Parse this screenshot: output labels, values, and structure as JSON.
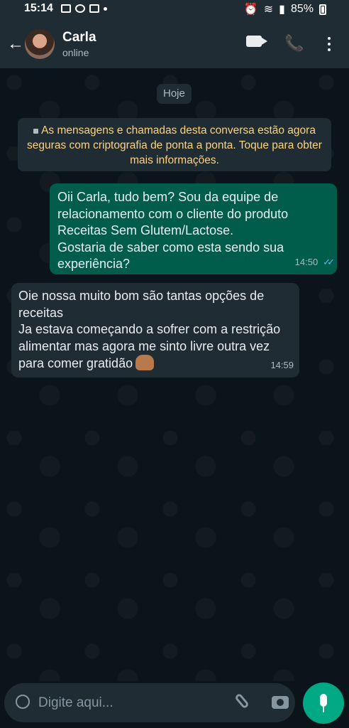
{
  "status": {
    "time": "15:14",
    "battery": "85%"
  },
  "header": {
    "contact_name": "Carla",
    "presence": "online"
  },
  "chat": {
    "date_chip": "Hoje",
    "encryption_notice": "As mensagens e chamadas desta conversa estão agora seguras com criptografia de ponta a ponta. Toque para obter mais informações.",
    "messages": [
      {
        "direction": "outgoing",
        "text": "Oii Carla, tudo bem? Sou da equipe de relacionamento com o cliente do produto Receitas Sem Glutem/Lactose.\nGostaria de saber como esta sendo sua experiência?",
        "time": "14:50",
        "status": "read"
      },
      {
        "direction": "incoming",
        "text": "Oie nossa muito bom são tantas opções de receitas\nJa estava começando a sofrer com a restrição alimentar mas agora me sinto livre outra vez para comer gratidão",
        "time": "14:59",
        "emoji": "raising-hands-emoji"
      }
    ]
  },
  "composer": {
    "placeholder": "Digite aqui..."
  },
  "colors": {
    "header_bg": "#1f2c34",
    "outgoing_bubble": "#005c4b",
    "incoming_bubble": "#1f2c34",
    "mic_button": "#00a884",
    "encryption_text": "#ffd279"
  }
}
